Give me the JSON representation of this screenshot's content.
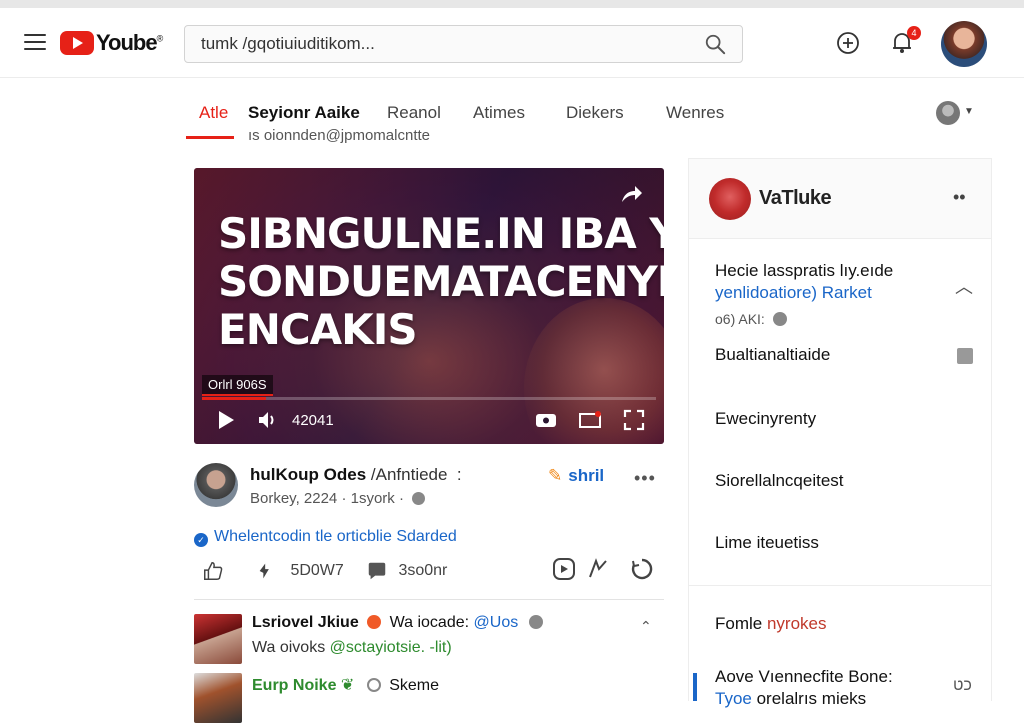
{
  "app": {
    "logo_text": "Yoube",
    "logo_sup": "®",
    "accent": "#e62117",
    "link_color": "#1a66c8"
  },
  "header": {
    "search_value": "tumk /ɡqotiuiuditikom...",
    "notification_count": "4",
    "icons": [
      "menu-icon",
      "search-icon",
      "upload-icon",
      "notification-icon",
      "avatar"
    ]
  },
  "tabs": [
    {
      "label": "Atle",
      "active": true
    },
    {
      "label": "Seyionr Aaike",
      "active": false
    },
    {
      "label": "Reanol",
      "active": false
    },
    {
      "label": "Atimes",
      "active": false
    },
    {
      "label": "Diekers",
      "active": false
    },
    {
      "label": "Wenres",
      "active": false
    }
  ],
  "subtitle": "ıs oionnden@jpmomalcntte",
  "video": {
    "title_lines": [
      "SIBNGULNE.IN IBA YIOR",
      "SONDUEMATACENYRE",
      "ENCAKIS"
    ],
    "chip_label": "Orlrl 906S",
    "time": "42041",
    "progress": 0.14
  },
  "channel": {
    "name": "hulKoup Odes",
    "name_extra": "/Anfntiede",
    "meta": "Borkey, 2224 · 1syork ·",
    "share_label": "shril",
    "more": "•••",
    "verified_text": "Whelentcodin tle orticblie Sdarded"
  },
  "actions": {
    "likes": "5D0W7",
    "comments": "3so0nr"
  },
  "comments": [
    {
      "name": "Lsriovel Jkiue",
      "tag": "Wa iocade:",
      "handle": "@Uos",
      "sub_prefix": "Wa oivoks",
      "sub_green": "@sctayiotsie. -lit)"
    },
    {
      "name": "Eurp Noike",
      "tag": "",
      "handle": "",
      "sub_prefix": "Skeme",
      "sub_green": ""
    }
  ],
  "right_panel": {
    "title": "VaTluke",
    "dots": "••",
    "item1_line1": "Hecie lasspratis lıy.eıde",
    "item1_line2": "yenlidoatiore) Rarket",
    "item1_meta": "o6) AKI:",
    "items": [
      "Bualtianaltiaide",
      "Ewecinyrenty",
      "Siorellalncqeitest",
      "Lime iteuetiss"
    ],
    "section_label": "Fomle",
    "section_highlight": "nyrokes",
    "bottom_line1": "Aove Vıennecfite Bone:",
    "bottom_line2_blue": "Tyoe",
    "bottom_line2": "orelalrıs mieks",
    "bottom_icon": "כט"
  }
}
